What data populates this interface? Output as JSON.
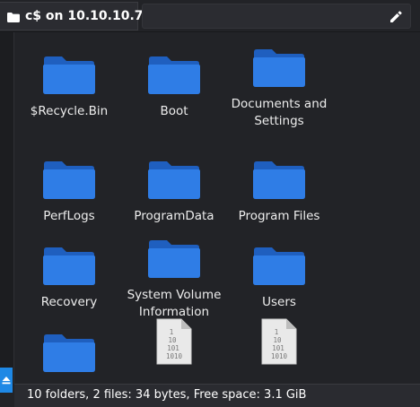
{
  "location": {
    "label": "c$ on 10.10.10.74",
    "icon": "folder-icon"
  },
  "toolbar": {
    "path_value": "",
    "edit_icon": "pencil-icon"
  },
  "colors": {
    "folder": "#2f7de6",
    "folder_dark": "#1f5fbf",
    "accent": "#1e88e5",
    "background": "#222327"
  },
  "items": [
    {
      "name": "$Recycle.Bin",
      "type": "folder"
    },
    {
      "name": "Boot",
      "type": "folder"
    },
    {
      "name": "Documents and Settings",
      "type": "folder"
    },
    {
      "name": "PerfLogs",
      "type": "folder"
    },
    {
      "name": "ProgramData",
      "type": "folder"
    },
    {
      "name": "Program Files",
      "type": "folder"
    },
    {
      "name": "Recovery",
      "type": "folder"
    },
    {
      "name": "System Volume Information",
      "type": "folder"
    },
    {
      "name": "Users",
      "type": "folder"
    },
    {
      "name": "",
      "type": "folder"
    },
    {
      "name": "",
      "type": "file"
    },
    {
      "name": "",
      "type": "file"
    }
  ],
  "status": {
    "text": "10 folders, 2 files: 34 bytes, Free space: 3.1 GiB"
  }
}
